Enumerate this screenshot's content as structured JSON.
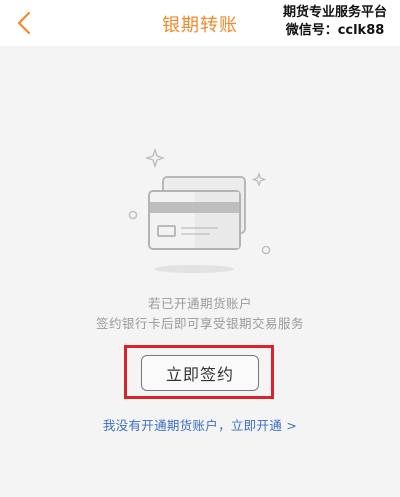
{
  "header": {
    "title": "银期转账",
    "back_icon": "chevron-left-icon",
    "accent_color": "#f08a2c"
  },
  "watermark": {
    "line1": "期货专业服务平台",
    "line2": "微信号：cclk88"
  },
  "empty_state": {
    "illustration_icon": "bank-cards-icon",
    "line1": "若已开通期货账户",
    "line2": "签约银行卡后即可享受银期交易服务"
  },
  "actions": {
    "sign_label": "立即签约",
    "open_account_link": "我没有开通期货账户，立即开通 >",
    "highlight_color": "#d9232a",
    "link_color": "#3b6fc4"
  }
}
